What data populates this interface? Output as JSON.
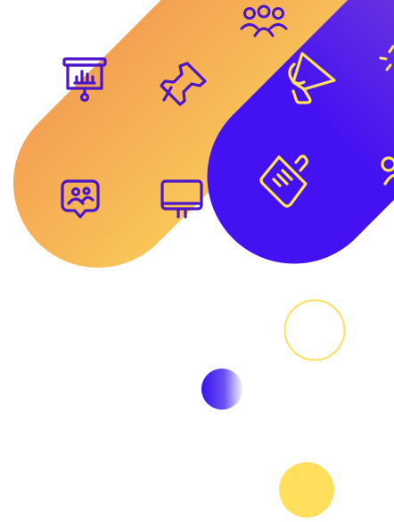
{
  "colors": {
    "orange": "#F2934C",
    "yellow": "#FFDF5C",
    "violet": "#8A4FCF",
    "indigo": "#4A12F0",
    "icon_on_warm": "#4A16C8",
    "icon_on_cool": "#FFE35C"
  },
  "icons": [
    "team-icon",
    "presentation-board-icon",
    "pushpin-icon",
    "megaphone-icon",
    "sparkle-icon",
    "video-call-chat-icon",
    "monitor-icon",
    "document-icon",
    "user-icon"
  ]
}
